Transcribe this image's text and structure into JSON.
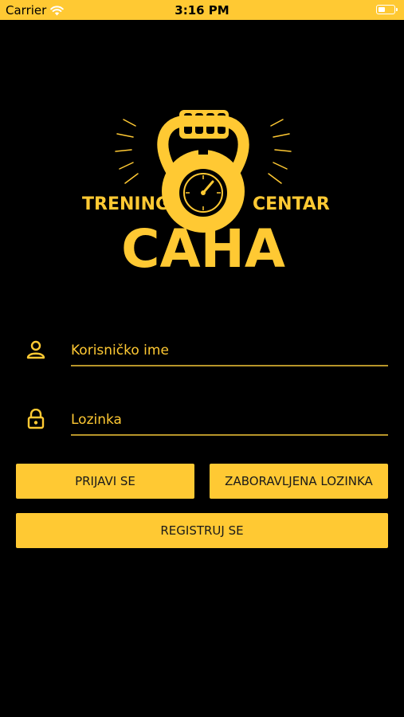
{
  "status_bar": {
    "carrier": "Carrier",
    "time": "3:16 PM",
    "icons": [
      "wifi-icon",
      "battery-icon"
    ]
  },
  "logo": {
    "left_text": "TRENING",
    "right_text": "CENTAR",
    "main_text": "CAHA"
  },
  "form": {
    "username": {
      "placeholder": "Korisničko ime",
      "value": "",
      "icon": "user-icon"
    },
    "password": {
      "placeholder": "Lozinka",
      "value": "",
      "icon": "lock-icon"
    }
  },
  "buttons": {
    "login": "PRIJAVI SE",
    "forgot_password": "ZABORAVLJENA LOZINKA",
    "register": "REGISTRUJ SE"
  },
  "colors": {
    "accent": "#FFC933",
    "background": "#000000",
    "underline": "#B8952A"
  }
}
